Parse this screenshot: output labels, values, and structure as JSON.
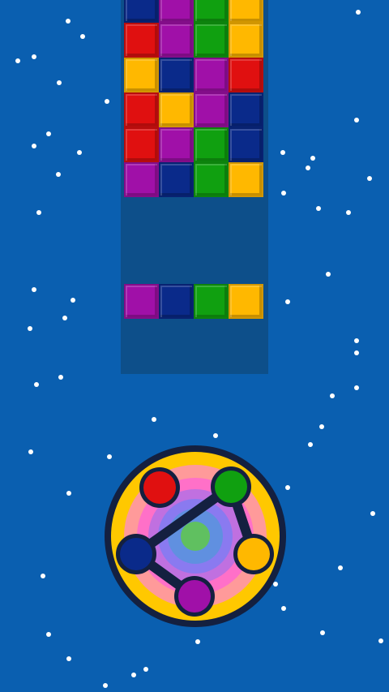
{
  "colors": {
    "background": "#0a5fb0",
    "column": "#0d4f8a",
    "red": "#e01010",
    "purple": "#a010a8",
    "navy": "#0a2a8a",
    "green": "#10a010",
    "yellow": "#ffb800",
    "outline": "#142040"
  },
  "board": {
    "columns": 4,
    "rows_top": [
      [
        "navy",
        "purple",
        "green",
        "yellow"
      ],
      [
        "red",
        "purple",
        "green",
        "yellow"
      ],
      [
        "yellow",
        "navy",
        "purple",
        "red"
      ],
      [
        "red",
        "yellow",
        "purple",
        "navy"
      ],
      [
        "red",
        "purple",
        "green",
        "navy"
      ],
      [
        "purple",
        "navy",
        "green",
        "yellow"
      ]
    ],
    "falling_row": [
      "purple",
      "navy",
      "green",
      "yellow"
    ]
  },
  "wheel": {
    "rings": [
      "#ffc800",
      "#ff9a9a",
      "#ff70c8",
      "#c070e0",
      "#8a7af0",
      "#6090e0"
    ],
    "center_color": "#60c060",
    "nodes": [
      "red",
      "green",
      "yellow",
      "purple",
      "navy"
    ],
    "links": [
      [
        "green",
        "navy"
      ],
      [
        "green",
        "yellow"
      ],
      [
        "navy",
        "purple"
      ]
    ]
  }
}
